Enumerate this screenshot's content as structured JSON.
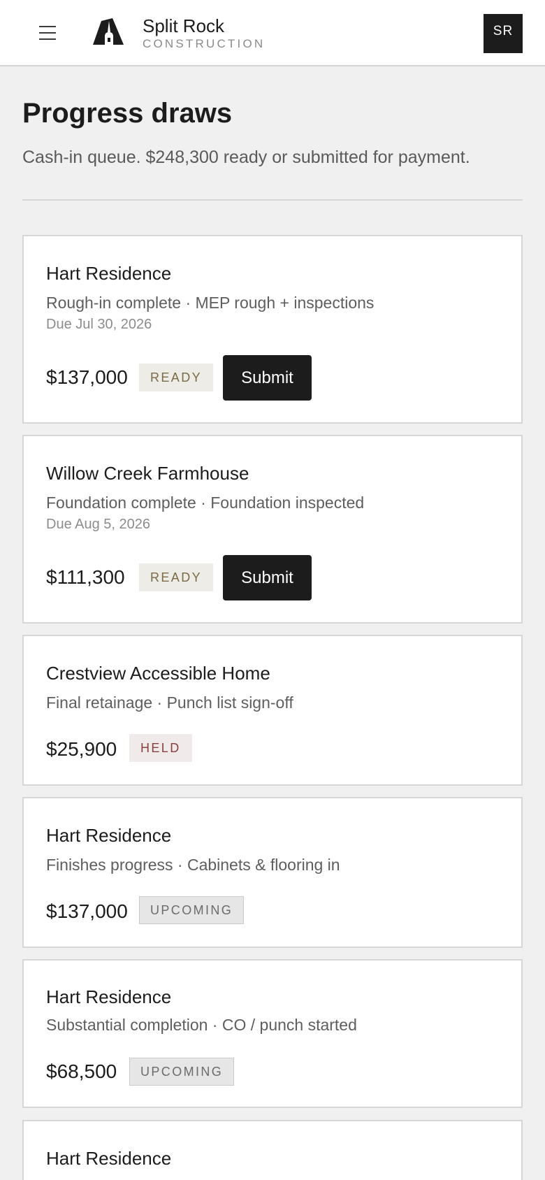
{
  "header": {
    "brand_name": "Split Rock",
    "brand_sub": "CONSTRUCTION",
    "avatar_initials": "SR"
  },
  "page": {
    "title": "Progress draws",
    "subtitle": "Cash-in queue. $248,300 ready or submitted for payment."
  },
  "draws": [
    {
      "project": "Hart Residence",
      "description": "Rough-in complete · MEP rough + inspections",
      "due": "Due Jul 30, 2026",
      "amount": "$137,000",
      "status": "READY",
      "action_label": "Submit"
    },
    {
      "project": "Willow Creek Farmhouse",
      "description": "Foundation complete · Foundation inspected",
      "due": "Due Aug 5, 2026",
      "amount": "$111,300",
      "status": "READY",
      "action_label": "Submit"
    },
    {
      "project": "Crestview Accessible Home",
      "description": "Final retainage · Punch list sign-off",
      "amount": "$25,900",
      "status": "HELD"
    },
    {
      "project": "Hart Residence",
      "description": "Finishes progress · Cabinets & flooring in",
      "amount": "$137,000",
      "status": "UPCOMING"
    },
    {
      "project": "Hart Residence",
      "description": "Substantial completion · CO / punch started",
      "amount": "$68,500",
      "status": "UPCOMING"
    },
    {
      "project": "Hart Residence"
    }
  ],
  "colors": {
    "primary": "#1c1c1c",
    "background": "#f0f0f0",
    "ready_badge_bg": "#eeece6",
    "ready_badge_text": "#7a6a45",
    "held_badge_bg": "#f1eaea",
    "held_badge_text": "#8a3f3f",
    "upcoming_badge_bg": "#e6e6e6",
    "upcoming_badge_text": "#6b6b6b"
  },
  "icons": {
    "menu": "hamburger-menu-icon",
    "logo": "split-rock-logo"
  }
}
